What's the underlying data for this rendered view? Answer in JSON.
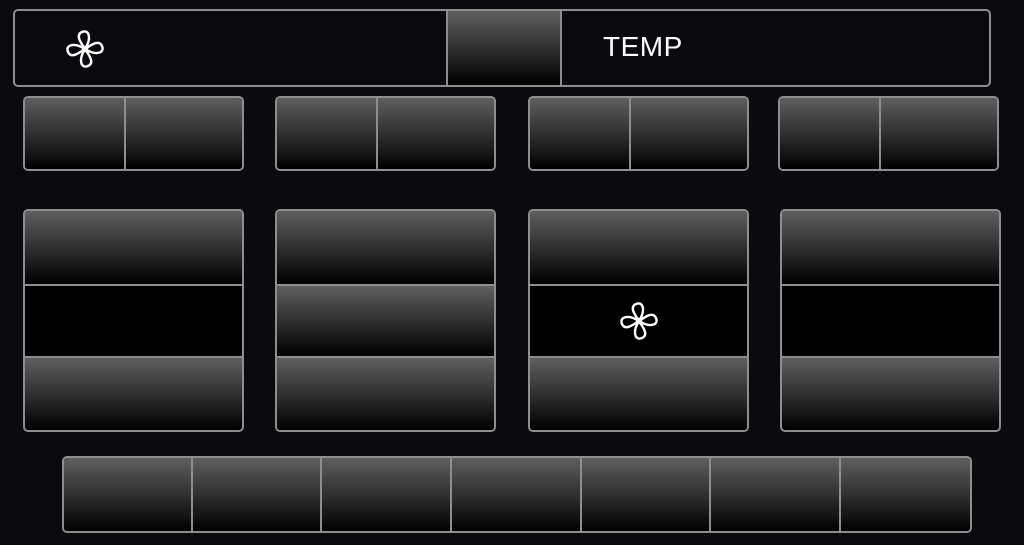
{
  "header": {
    "temp_label": "TEMP",
    "fan_icon": "fan-icon"
  },
  "fan_speed": {
    "selected_level": 2,
    "levels": 4
  },
  "bottom_bar": {
    "segment_count": 7
  },
  "colors": {
    "background": "#0b0a0f",
    "border": "#8e8e8e",
    "button_top": "#5f5f5f",
    "button_bottom": "#000000",
    "icon": "#ffffff"
  }
}
